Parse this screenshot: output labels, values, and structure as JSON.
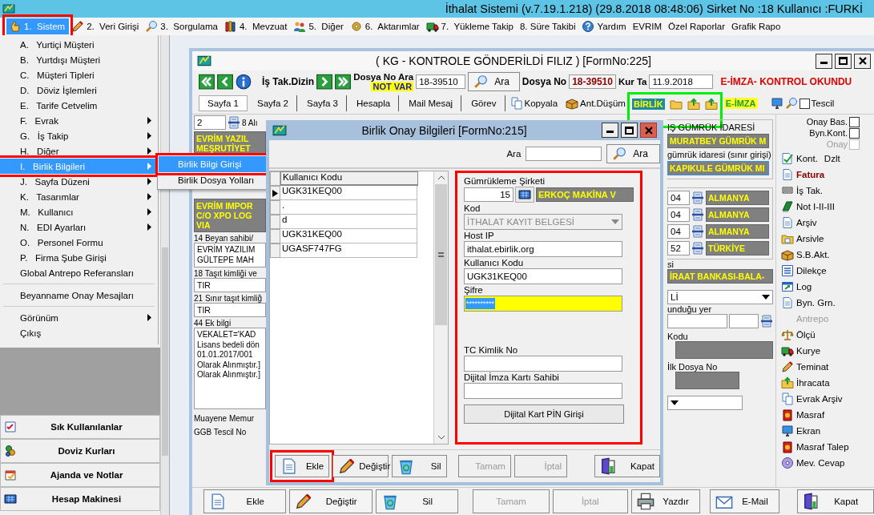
{
  "app_title": "İthalat Sistemi (v.7.19.1.218) (29.8.2018 08:48:06) Sirket No :18 Kullanıcı :FURKİ",
  "menubar": [
    {
      "label": "1.  Sistem",
      "selected": true
    },
    {
      "label": "2.  Veri Girişi",
      "selected": false
    },
    {
      "label": "3.  Sorgulama",
      "selected": false
    },
    {
      "label": "4.  Mevzuat",
      "selected": false
    },
    {
      "label": "5.  Diğer",
      "selected": false
    },
    {
      "label": "6.  Aktarımlar",
      "selected": false
    },
    {
      "label": "7.  Yükleme Takip",
      "selected": false
    },
    {
      "label": "8. Süre Takibi",
      "selected": false
    },
    {
      "label": "Yardım",
      "selected": false
    },
    {
      "label": "EVRIM",
      "selected": false
    },
    {
      "label": "Özel Raporlar",
      "selected": false
    },
    {
      "label": "Grafik Rapo",
      "selected": false
    }
  ],
  "system_menu": [
    {
      "kind": "item",
      "label": "A.   Yurtiçi Müşteri",
      "submenu": false,
      "selected": false
    },
    {
      "kind": "item",
      "label": "B.   Yurtdışı Müşteri",
      "submenu": false,
      "selected": false
    },
    {
      "kind": "item",
      "label": "C.   Müşteri Tipleri",
      "submenu": false,
      "selected": false
    },
    {
      "kind": "item",
      "label": "D.   Döviz İşlemleri",
      "submenu": false,
      "selected": false
    },
    {
      "kind": "item",
      "label": "E.   Tarife Cetvelim",
      "submenu": false,
      "selected": false
    },
    {
      "kind": "item",
      "label": "F.   Evrak",
      "submenu": true,
      "selected": false
    },
    {
      "kind": "item",
      "label": "G.   İş Takip",
      "submenu": true,
      "selected": false
    },
    {
      "kind": "item",
      "label": "H.   Diğer",
      "submenu": true,
      "selected": false
    },
    {
      "kind": "item",
      "label": "I.   Birlik Bilgileri",
      "submenu": true,
      "selected": true
    },
    {
      "kind": "item",
      "label": "J.   Sayfa Düzeni",
      "submenu": true,
      "selected": false
    },
    {
      "kind": "item",
      "label": "K.   Tasarımlar",
      "submenu": true,
      "selected": false
    },
    {
      "kind": "item",
      "label": "M.   Kullanıcı",
      "submenu": true,
      "selected": false
    },
    {
      "kind": "item",
      "label": "N.   EDI Ayarları",
      "submenu": true,
      "selected": false
    },
    {
      "kind": "item",
      "label": "O.   Personel Formu",
      "submenu": false,
      "selected": false
    },
    {
      "kind": "item",
      "label": "P.   Firma Şube Girişi",
      "submenu": false,
      "selected": false
    },
    {
      "kind": "item",
      "label": "Global Antrepo Referansları",
      "submenu": false,
      "selected": false
    },
    {
      "kind": "separator"
    },
    {
      "kind": "item",
      "label": "Beyanname Onay Mesajları",
      "submenu": false,
      "selected": false
    },
    {
      "kind": "separator"
    },
    {
      "kind": "item",
      "label": "Görünüm",
      "submenu": true,
      "selected": false
    },
    {
      "kind": "item",
      "label": "Çıkış",
      "submenu": false,
      "selected": false
    }
  ],
  "submenu": [
    {
      "label": "Birlik Bilgi Girişi",
      "selected": true
    },
    {
      "label": "Birlik Dosya Yolları",
      "selected": false
    }
  ],
  "side_nav": [
    "Sık Kullanılanlar",
    "Doviz Kurları",
    "Ajanda ve Notlar",
    "Hesap Makinesi"
  ],
  "form": {
    "title": "( KG  - KONTROLE GÖNDERİLDİ FILIZ ) [FormNo:225]",
    "toolbar": {
      "dizin_label": "İş Tak.Dizin",
      "search_label": "Dosya No Ara",
      "search_value": "18-39510",
      "search_button": "Ara",
      "note_badge": "NOT VAR",
      "file_label": "Dosya No",
      "file_no": "18-39510",
      "rate_label": "Kur Ta",
      "rate_date": "11.9.2018",
      "status": "E-İMZA- KONTROL OKUNDU"
    },
    "tabs": [
      {
        "label": "Sayfa 1",
        "selected": true
      },
      {
        "label": "Sayfa 2",
        "selected": false
      },
      {
        "label": "Sayfa 3",
        "selected": false
      },
      {
        "label": "Hesapla",
        "selected": false
      },
      {
        "label": "Mail Mesaj",
        "selected": false
      },
      {
        "label": "Görev",
        "selected": false
      }
    ],
    "tab_actions": {
      "copy": "Kopyala",
      "ant": "Ant.Düşüm",
      "birlik": "BİRLİK",
      "eimza": "E-İMZA",
      "tescil": {
        "label": "Tescil",
        "checked": false
      }
    },
    "left": {
      "count": "2",
      "count_label": "8 Alı",
      "sender": [
        "EVRİM YAZIL",
        "MEŞRUTİYET"
      ],
      "receiver": [
        "EVRİM IMPOR",
        "C/O XPO LOG",
        "VIA"
      ],
      "declarant_label": "14 Beyan sahibi/",
      "declarant": [
        "EVRİM YAZILIM",
        "GÜLTEPE MAH"
      ],
      "vehicle_label": "18 Taşıt kimliği ve",
      "vehicle": "TIR",
      "border_vehicle_label": "21 Sınır taşıt kimliğ",
      "border_vehicle": "TIR",
      "info_label": "44 Ek bilgi",
      "info": [
        "VEKALET='KAD",
        "Lisans bedeli dön",
        "01.01.2017/001",
        "Olarak Alınmıştır.]",
        "Olarak Alınmıştır.]"
      ],
      "inspector_label": "Muayene Memur",
      "ggb_label": "GGB Tescil No"
    },
    "right": {
      "exit_office_label": "IŞ GÜMRÜK İDARESİ",
      "exit_office": "MURATBEY GÜMRÜK M",
      "entry_office_label": "gümrük idaresi (sınır girişi)",
      "entry_office": "KAPIKULE GÜMRÜK MI",
      "countries": [
        {
          "code": "04",
          "name": "ALMANYA"
        },
        {
          "code": "04",
          "name": "ALMANYA"
        },
        {
          "code": "04",
          "name": "ALMANYA"
        },
        {
          "code": "52",
          "name": "TÜRKİYE"
        }
      ],
      "bank_label": "si",
      "bank": "İRAAT BANKASI-BALA-",
      "select_value": "Lİ",
      "location_label": "unduğu yer",
      "code_label": "Kodu",
      "first_file_label": "İlk Dosya No"
    },
    "side_checks": [
      {
        "label": "Onay Bas.",
        "checked": false,
        "disabled": false
      },
      {
        "label": "Byn.Kont.",
        "checked": false,
        "disabled": false
      },
      {
        "label": "Onay",
        "checked": false,
        "disabled": true
      }
    ],
    "side_tools": [
      {
        "label": "Kont.",
        "extra": "Dzlt",
        "emphasized": false,
        "disabled": false
      },
      {
        "label": "Fatura",
        "emphasized": true,
        "disabled": false
      },
      {
        "label": "İş Tak.",
        "emphasized": false,
        "disabled": false
      },
      {
        "label": "Not I-II-III",
        "emphasized": false,
        "disabled": false
      },
      {
        "label": "Arşiv",
        "emphasized": false,
        "disabled": false
      },
      {
        "label": "Arsivle",
        "emphasized": false,
        "disabled": false
      },
      {
        "label": "S.B.Akt.",
        "emphasized": false,
        "disabled": false
      },
      {
        "label": "Dilekçe",
        "emphasized": false,
        "disabled": false
      },
      {
        "label": "Log",
        "emphasized": false,
        "disabled": false
      },
      {
        "label": "Byn. Grn.",
        "emphasized": false,
        "disabled": false
      },
      {
        "label": "Antrepo",
        "emphasized": false,
        "disabled": true
      },
      {
        "label": "Ölçü",
        "emphasized": false,
        "disabled": false
      },
      {
        "label": "Kurye",
        "emphasized": false,
        "disabled": false
      },
      {
        "label": "Teminat",
        "emphasized": false,
        "disabled": false
      },
      {
        "label": "İhracata",
        "emphasized": false,
        "disabled": false
      },
      {
        "label": "Evrak Arşiv",
        "emphasized": false,
        "disabled": false
      },
      {
        "label": "Masraf",
        "emphasized": false,
        "disabled": false
      },
      {
        "label": "Ekran",
        "emphasized": false,
        "disabled": false
      },
      {
        "label": "Masraf Talep",
        "emphasized": false,
        "disabled": false
      },
      {
        "label": "Mev. Cevap",
        "emphasized": false,
        "disabled": false
      }
    ],
    "buttons": [
      {
        "label": "Ekle",
        "disabled": false
      },
      {
        "label": "Değiştir",
        "disabled": false
      },
      {
        "label": "Sil",
        "disabled": false
      },
      {
        "label": "Tamam",
        "disabled": true
      },
      {
        "label": "İptal",
        "disabled": true
      },
      {
        "label": "Yazdır",
        "disabled": false
      },
      {
        "label": "E-Mail",
        "disabled": false
      },
      {
        "label": "Kapat",
        "disabled": false
      }
    ]
  },
  "dialog": {
    "title": "Birlik Onay Bilgileri [FormNo:215]",
    "search_label": "Ara",
    "search_button": "Ara",
    "grid_column": "Kullanıcı Kodu",
    "rows": [
      {
        "code": "UGK31KEQ00",
        "selected": true
      },
      {
        "code": ".",
        "selected": false
      },
      {
        "code": "d",
        "selected": false
      },
      {
        "code": "UGK31KEQ00",
        "selected": false
      },
      {
        "code": "UGASF747FG",
        "selected": false
      }
    ],
    "company_label": "Gümrükleme Şirketi",
    "company_no": "15",
    "company_name": "ERKOÇ MAKİNA V",
    "kod_label": "Kod",
    "kod_value": "İTHALAT KAYIT BELGESİ",
    "kod_disabled": true,
    "host_label": "Host IP",
    "host_value": "ithalat.ebirlik.org",
    "user_label": "Kullanıcı Kodu",
    "user_value": "UGK31KEQ00",
    "password_label": "Şifre",
    "password_value": "**********",
    "tc_label": "TC Kimlik No",
    "card_owner_label": "Dijital İmza Kartı Sahibi",
    "pin_button": "Dijital Kart PİN Girişi",
    "buttons": [
      {
        "label": "Ekle",
        "disabled": false
      },
      {
        "label": "Değiştir",
        "disabled": false
      },
      {
        "label": "Sil",
        "disabled": false
      },
      {
        "label": "Tamam",
        "disabled": true
      },
      {
        "label": "İptal",
        "disabled": true
      },
      {
        "label": "Kapat",
        "disabled": false
      }
    ]
  }
}
